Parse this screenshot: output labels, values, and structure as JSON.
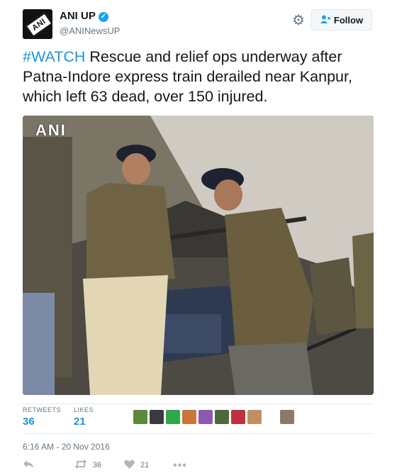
{
  "header": {
    "name": "ANI UP",
    "handle": "@ANINewsUP",
    "avatar_text": "ANI",
    "follow_label": "Follow"
  },
  "tweet": {
    "hashtag": "#WATCH",
    "text": " Rescue and relief ops underway after Patna-Indore express train derailed near Kanpur, which left 63 dead, over 150 injured."
  },
  "media": {
    "watermark": "ANI"
  },
  "stats": {
    "retweets_label": "RETWEETS",
    "retweets": "36",
    "likes_label": "LIKES",
    "likes": "21"
  },
  "timestamp": "6:16 AM - 20 Nov 2016",
  "actions": {
    "retweet_count": "36",
    "like_count": "21"
  },
  "colors": {
    "link": "#1b95e0",
    "verified": "#1da1f2",
    "muted": "#657786",
    "action_icon": "#aab8c2"
  },
  "icons": [
    "verified-badge-icon",
    "gear-icon",
    "follow-user-icon",
    "reply-icon",
    "retweet-icon",
    "heart-icon",
    "more-icon"
  ]
}
